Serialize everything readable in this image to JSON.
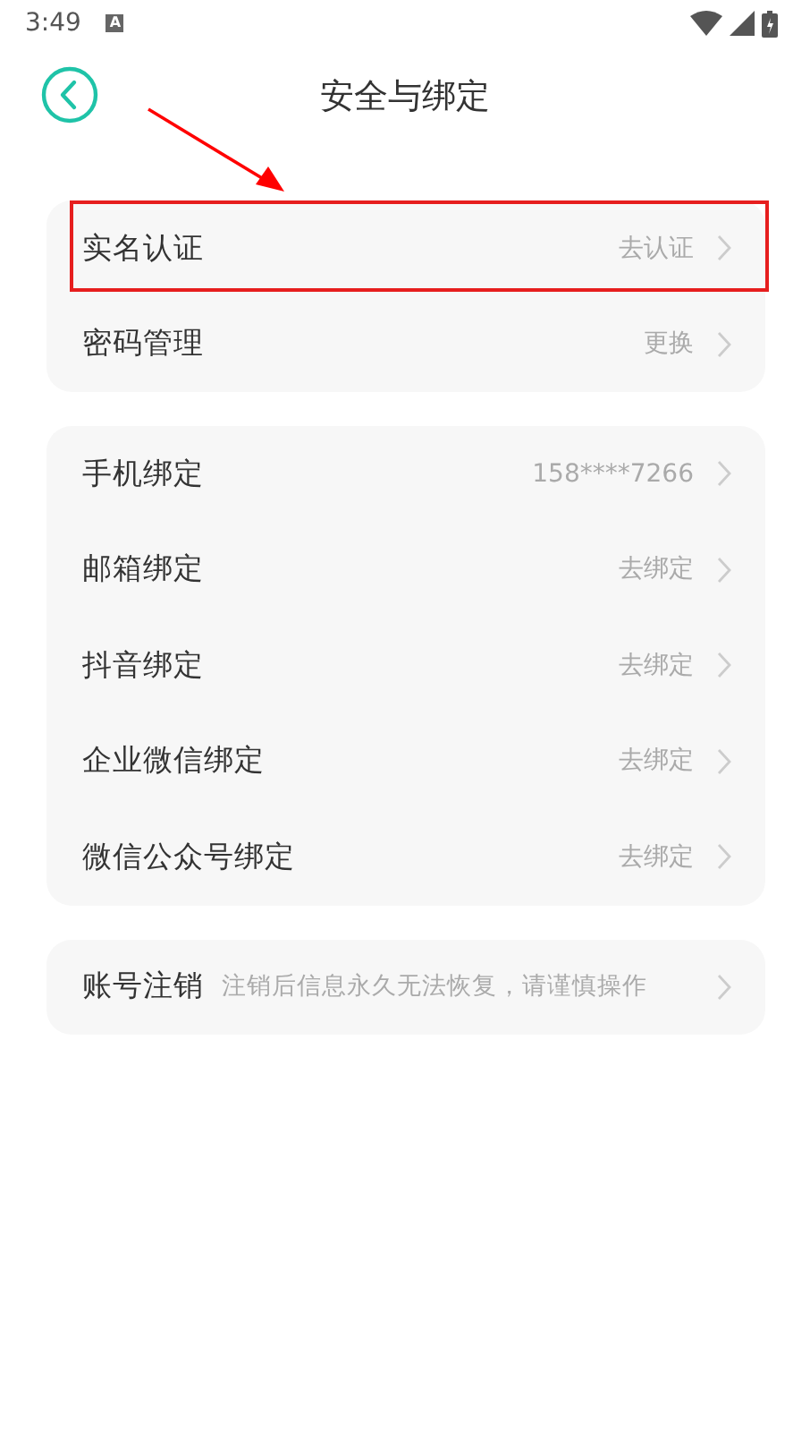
{
  "status_bar": {
    "time": "3:49",
    "notification": "A"
  },
  "header": {
    "title": "安全与绑定"
  },
  "groups": [
    {
      "rows": [
        {
          "label": "实名认证",
          "value": "去认证",
          "highlighted": true
        },
        {
          "label": "密码管理",
          "value": "更换",
          "highlighted": false
        }
      ]
    },
    {
      "rows": [
        {
          "label": "手机绑定",
          "value": "158****7266",
          "highlighted": false
        },
        {
          "label": "邮箱绑定",
          "value": "去绑定",
          "highlighted": false
        },
        {
          "label": "抖音绑定",
          "value": "去绑定",
          "highlighted": false
        },
        {
          "label": "企业微信绑定",
          "value": "去绑定",
          "highlighted": false
        },
        {
          "label": "微信公众号绑定",
          "value": "去绑定",
          "highlighted": false
        }
      ]
    },
    {
      "rows": [
        {
          "label": "账号注销",
          "description": "注销后信息永久无法恢复，请谨慎操作",
          "highlighted": false
        }
      ]
    }
  ]
}
